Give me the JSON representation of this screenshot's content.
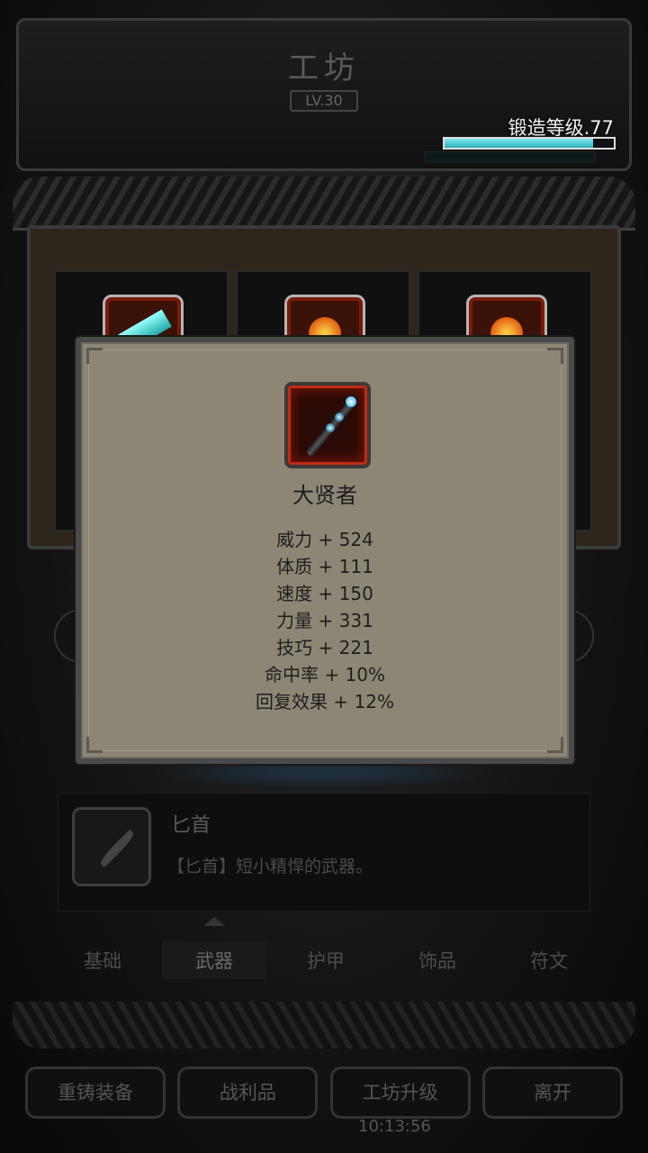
{
  "header": {
    "title": "工坊",
    "level": "LV.30"
  },
  "forge": {
    "label": "锻造等级.77",
    "progress": 0.88
  },
  "popup": {
    "item_name": "大贤者",
    "icon": "staff-icon",
    "stats": [
      "威力 + 524",
      "体质 + 111",
      "速度 + 150",
      "力量 + 331",
      "技巧 + 221",
      "命中率 + 10%",
      "回复效果 + 12%"
    ]
  },
  "selected_item": {
    "name": "匕首",
    "description": "【匕首】短小精悍的武器。",
    "icon": "dagger-icon"
  },
  "tabs": [
    "基础",
    "武器",
    "护甲",
    "饰品",
    "符文"
  ],
  "active_tab": "武器",
  "buttons": [
    "重铸装备",
    "战利品",
    "工坊升级",
    "离开"
  ],
  "clock": "10:13:56",
  "colors": {
    "forge_bar": "#2fb0bc",
    "popup_bg": "#8d8674",
    "slot_border": "#c22a12"
  }
}
